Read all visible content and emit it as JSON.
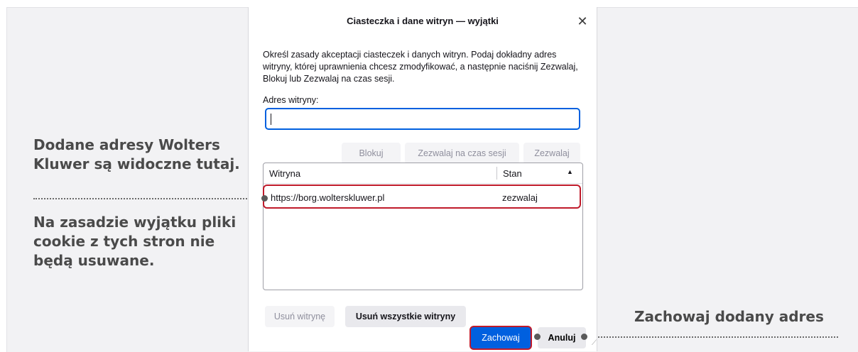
{
  "dialog": {
    "title": "Ciasteczka i dane witryn — wyjątki",
    "close_glyph": "✕",
    "description": "Określ zasady akceptacji ciasteczek i danych witryn. Podaj dokładny adres witryny, której uprawnienia chcesz zmodyfikować, a następnie naciśnij Zezwalaj, Blokuj lub Zezwalaj na czas sesji.",
    "address_label": "Adres witryny:",
    "address_value": "",
    "buttons": {
      "block": "Blokuj",
      "allow_session": "Zezwalaj na czas sesji",
      "allow": "Zezwalaj",
      "remove": "Usuń witrynę",
      "remove_all": "Usuń wszystkie witryny",
      "save": "Zachowaj",
      "cancel": "Anuluj"
    },
    "table": {
      "columns": [
        "Witryna",
        "Stan"
      ],
      "sort_glyph": "▲",
      "rows": [
        {
          "site": "https://borg.wolterskluwer.pl",
          "state": "zezwalaj"
        }
      ]
    }
  },
  "annotations": {
    "note1": "Dodane adresy Wolters Kluwer są widoczne tutaj.",
    "note2": "Na zasadzie wyjątku pliki cookie z tych stron nie będą usuwane.",
    "note3": "Zachowaj dodany adres"
  },
  "colors": {
    "accent": "#0060df",
    "highlight_border": "#c01b2b",
    "annotation_text": "#4a4a4a"
  }
}
